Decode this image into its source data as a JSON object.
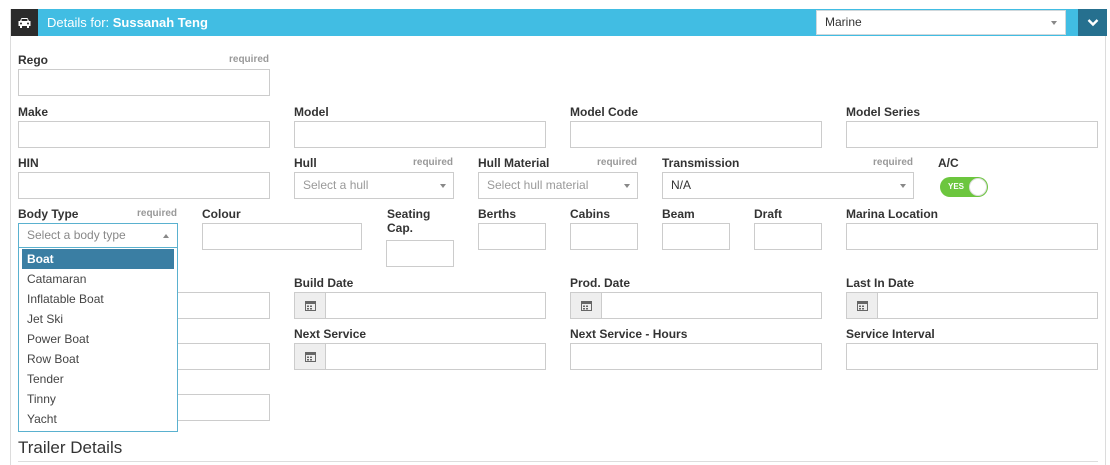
{
  "header": {
    "title_prefix": "Details for:",
    "customer_name": "Sussanah Teng",
    "icon": "car-icon",
    "vehicle_type_selected": "Marine",
    "collapse_icon": "chevron-down-icon",
    "colors": {
      "bar": "#41bde3",
      "icon_box": "#2b2b2b",
      "collapse_box": "#26708f"
    }
  },
  "required_text": "required",
  "fields": {
    "rego": "Rego",
    "make": "Make",
    "model": "Model",
    "model_code": "Model Code",
    "model_series": "Model Series",
    "hin": "HIN",
    "hull": "Hull",
    "hull_placeholder": "Select a hull",
    "hull_material": "Hull Material",
    "hull_material_placeholder": "Select hull material",
    "transmission": "Transmission",
    "transmission_value": "N/A",
    "ac": "A/C",
    "ac_toggle_text": "YES",
    "body_type": "Body Type",
    "body_type_placeholder": "Select a body type",
    "colour": "Colour",
    "seating_cap_line1": "Seating",
    "seating_cap_line2": "Cap.",
    "berths": "Berths",
    "cabins": "Cabins",
    "beam": "Beam",
    "draft": "Draft",
    "marina_location": "Marina Location",
    "build_date": "Build Date",
    "prod_date": "Prod. Date",
    "last_in_date": "Last In Date",
    "next_service": "Next Service",
    "next_service_hours": "Next Service - Hours",
    "service_interval": "Service Interval"
  },
  "body_type_options": [
    "Boat",
    "Catamaran",
    "Inflatable Boat",
    "Jet Ski",
    "Power Boat",
    "Row Boat",
    "Tender",
    "Tinny",
    "Yacht"
  ],
  "body_type_highlighted": "Boat",
  "section": {
    "trailer_details": "Trailer Details"
  }
}
